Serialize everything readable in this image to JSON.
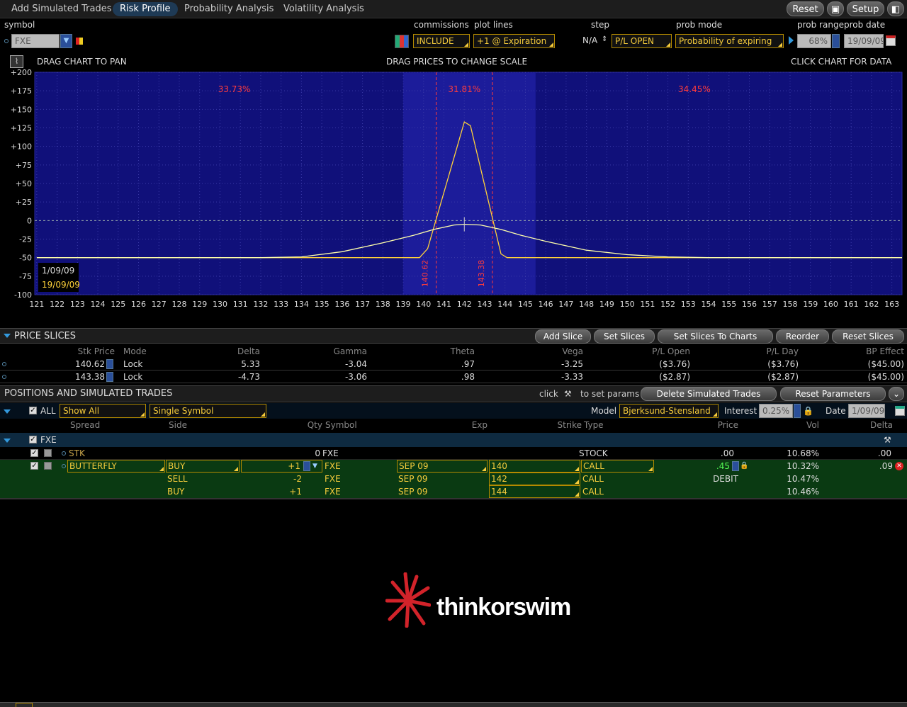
{
  "tabs": [
    {
      "label": "Add Simulated Trades"
    },
    {
      "label": "Risk Profile"
    },
    {
      "label": "Probability Analysis"
    },
    {
      "label": "Volatility Analysis"
    }
  ],
  "top_buttons": {
    "reset": "Reset",
    "setup": "Setup"
  },
  "controls": {
    "symbol_label": "symbol",
    "symbol_value": "FXE",
    "commissions_label": "commissions",
    "commissions_value": "INCLUDE",
    "plot_lines_label": "plot lines",
    "plot_lines_value": "+1 @ Expiration",
    "step_label": "step",
    "step_value": "N/A",
    "pl_value": "P/L OPEN",
    "prob_mode_label": "prob mode",
    "prob_mode_value": "Probability of expiring",
    "prob_range_label": "prob range",
    "prob_range_value": "68%",
    "prob_date_label": "prob date",
    "prob_date_value": "19/09/09"
  },
  "chart_header": {
    "left": "DRAG CHART TO PAN",
    "center": "DRAG PRICES TO CHANGE SCALE",
    "right": "CLICK CHART FOR DATA"
  },
  "chart_data": {
    "type": "line",
    "x_ticks": [
      121,
      122,
      123,
      124,
      125,
      126,
      127,
      128,
      129,
      130,
      131,
      132,
      133,
      134,
      135,
      136,
      137,
      138,
      139,
      140,
      141,
      142,
      143,
      144,
      145,
      146,
      147,
      148,
      149,
      150,
      151,
      152,
      153,
      154,
      155,
      156,
      157,
      158,
      159,
      160,
      161,
      162,
      163
    ],
    "y_ticks": [
      "+200",
      "+175",
      "+150",
      "+125",
      "+100",
      "+75",
      "+50",
      "+25",
      "0",
      "-25",
      "-50",
      "-75",
      "-100"
    ],
    "xlim": [
      120.9,
      163.5
    ],
    "ylim": [
      -100,
      200
    ],
    "probabilities": [
      {
        "label": "33.73%",
        "x": 130.7
      },
      {
        "label": "31.81%",
        "x": 142.0
      },
      {
        "label": "34.45%",
        "x": 153.3
      }
    ],
    "slice_lines": [
      {
        "x": 140.62,
        "label": "140.62"
      },
      {
        "x": 143.38,
        "label": "143.38"
      }
    ],
    "shaded_range": [
      139.0,
      145.5
    ],
    "dates": [
      "1/09/09",
      "19/09/09"
    ],
    "series": [
      {
        "color": "#ffd23a",
        "points": [
          [
            121,
            -50
          ],
          [
            139.8,
            -50
          ],
          [
            140.2,
            -38
          ],
          [
            142,
            133
          ],
          [
            142.3,
            128
          ],
          [
            143.8,
            -45
          ],
          [
            144.1,
            -50
          ],
          [
            163.5,
            -50
          ]
        ]
      },
      {
        "color": "#ffffaa",
        "points": [
          [
            121,
            -50
          ],
          [
            132,
            -50
          ],
          [
            134,
            -49
          ],
          [
            136,
            -42
          ],
          [
            138,
            -30
          ],
          [
            139.5,
            -20
          ],
          [
            140.5,
            -12
          ],
          [
            141.5,
            -6
          ],
          [
            142,
            -5
          ],
          [
            142.8,
            -6
          ],
          [
            143.8,
            -12
          ],
          [
            144.8,
            -20
          ],
          [
            146,
            -28
          ],
          [
            148,
            -40
          ],
          [
            150,
            -46
          ],
          [
            152,
            -49
          ],
          [
            154,
            -50
          ],
          [
            163.5,
            -50
          ]
        ]
      }
    ]
  },
  "price_slices": {
    "title": "PRICE SLICES",
    "buttons": [
      "Add Slice",
      "Set Slices",
      "Set Slices To Charts",
      "Reorder",
      "Reset Slices"
    ],
    "columns": [
      "Stk Price",
      "Mode",
      "Delta",
      "Gamma",
      "Theta",
      "Vega",
      "P/L Open",
      "P/L Day",
      "BP Effect"
    ],
    "rows": [
      [
        "140.62",
        "Lock",
        "5.33",
        "-3.04",
        ".97",
        "-3.25",
        "($3.76)",
        "($3.76)",
        "($45.00)"
      ],
      [
        "143.38",
        "Lock",
        "-4.73",
        "-3.06",
        ".98",
        "-3.33",
        "($2.87)",
        "($2.87)",
        "($45.00)"
      ]
    ]
  },
  "positions": {
    "title": "POSITIONS AND SIMULATED TRADES",
    "click_text": "click",
    "params_text": "to set params",
    "delete_button": "Delete Simulated Trades",
    "reset_button": "Reset Parameters",
    "all_label": "ALL",
    "show_all": "Show All",
    "single_symbol": "Single Symbol",
    "model_label": "Model",
    "model_value": "Bjerksund-Stensland",
    "interest_label": "Interest",
    "interest_value": "0.25%",
    "date_label": "Date",
    "date_value": "1/09/09",
    "columns": [
      "Spread",
      "Side",
      "Qty",
      "Symbol",
      "Exp",
      "Strike",
      "Type",
      "Price",
      "Vol",
      "Delta"
    ],
    "group": "FXE",
    "stk_row": {
      "spread": "STK",
      "qty": "0",
      "symbol": "FXE",
      "type": "STOCK",
      "price": ".00",
      "vol": "10.68%",
      "delta": ".00"
    },
    "legs": [
      {
        "spread": "BUTTERFLY",
        "side": "BUY",
        "qty": "+1",
        "symbol": "FXE",
        "exp": "SEP 09",
        "strike": "140",
        "type": "CALL",
        "price": ".45",
        "vol": "10.32%",
        "delta": ".09"
      },
      {
        "spread": "",
        "side": "SELL",
        "qty": "-2",
        "symbol": "FXE",
        "exp": "SEP 09",
        "strike": "142",
        "type": "CALL",
        "price": "DEBIT",
        "vol": "10.47%",
        "delta": ""
      },
      {
        "spread": "",
        "side": "BUY",
        "qty": "+1",
        "symbol": "FXE",
        "exp": "SEP 09",
        "strike": "144",
        "type": "CALL",
        "price": "",
        "vol": "10.46%",
        "delta": ""
      }
    ]
  },
  "brand": "thinkorswim"
}
